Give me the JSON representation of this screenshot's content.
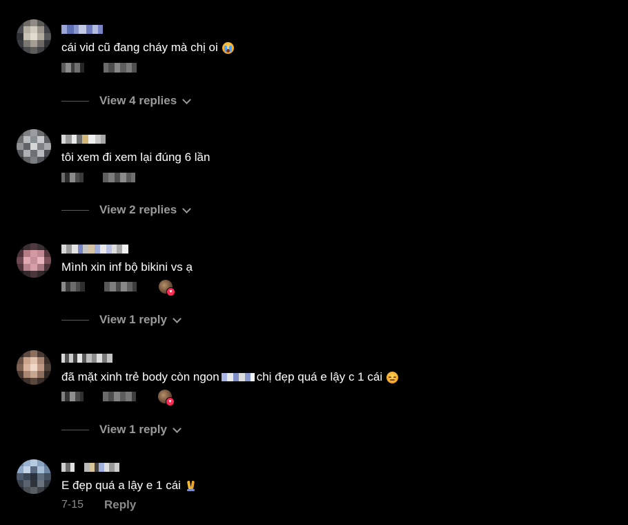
{
  "comments": [
    {
      "text": "cái vid cũ đang cháy mà chị oi",
      "emoji_icon": "loudly-crying-face",
      "view_replies_label": "View 4 replies",
      "liked_by_creator": false
    },
    {
      "text": "tôi xem đi xem lại đúng 6 lần",
      "view_replies_label": "View 2 replies",
      "liked_by_creator": false
    },
    {
      "text": "Mình xin inf bộ bikini vs ạ",
      "view_replies_label": "View 1 reply",
      "liked_by_creator": true
    },
    {
      "text_before": "đã mặt xinh trẻ body còn ngon",
      "text_after": "chị đẹp quá e lậy c 1 cái",
      "emoji_icon": "relieved-face",
      "view_replies_label": "View 1 reply",
      "liked_by_creator": true
    },
    {
      "text": "E đẹp quá a lậy e 1 cái",
      "emoji_icon": "folded-hands",
      "date": "7-15",
      "reply_label": "Reply"
    }
  ],
  "colors": {
    "background": "#000000",
    "text": "#ffffff",
    "muted": "#8a8a8a",
    "like_heart": "#fe2c55"
  }
}
